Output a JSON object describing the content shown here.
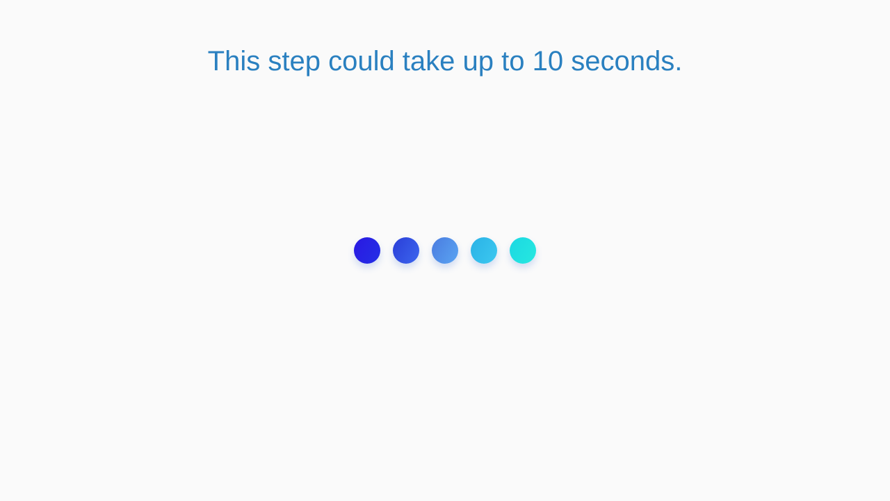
{
  "loading": {
    "message": "This step could take up to 10 seconds.",
    "dots": [
      {
        "name": "loading-dot-1",
        "color": "#2a1ce4"
      },
      {
        "name": "loading-dot-2",
        "color": "#2e4ee0"
      },
      {
        "name": "loading-dot-3",
        "color": "#5294ea"
      },
      {
        "name": "loading-dot-4",
        "color": "#33bde8"
      },
      {
        "name": "loading-dot-5",
        "color": "#20e2e1"
      }
    ]
  },
  "colors": {
    "background": "#fafafa",
    "message_text": "#2a80c0"
  }
}
